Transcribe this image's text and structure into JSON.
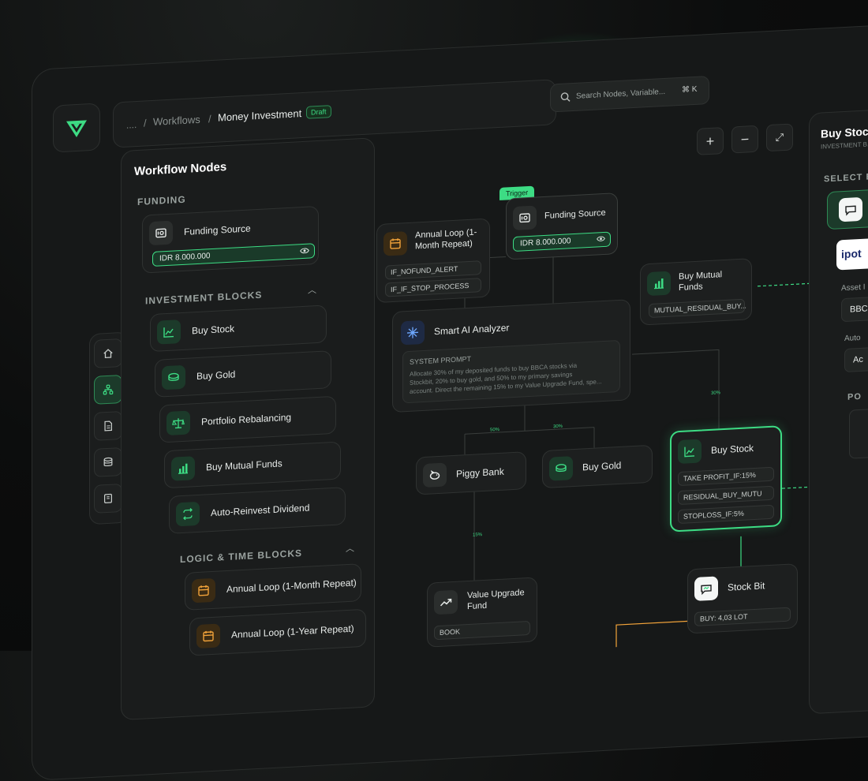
{
  "breadcrumb": {
    "ellipsis": "....",
    "sep1": "/",
    "workflows": "Workflows",
    "sep2": "/",
    "current": "Money Investment",
    "badge": "Draft"
  },
  "search": {
    "placeholder": "Search Nodes, Variable...",
    "shortcut": "⌘ K"
  },
  "toolbar": {
    "zoom_in": "+",
    "zoom_out": "−",
    "fullscreen": "⤢"
  },
  "left_panel": {
    "title": "Workflow Nodes",
    "funding_section": "FUNDING",
    "funding_node": {
      "label": "Funding Source",
      "value": "IDR 8.000.000"
    },
    "investment_section": "INVESTMENT BLOCKS",
    "investment_items": [
      {
        "label": "Buy Stock",
        "icon": "stock-chart-icon"
      },
      {
        "label": "Buy Gold",
        "icon": "gold-coin-icon"
      },
      {
        "label": "Portfolio Rebalancing",
        "icon": "balance-scale-icon"
      },
      {
        "label": "Buy Mutual Funds",
        "icon": "bar-chart-icon"
      },
      {
        "label": "Auto-Reinvest Dividend",
        "icon": "repeat-icon"
      }
    ],
    "logic_section": "LOGIC & TIME BLOCKS",
    "logic_items": [
      {
        "label": "Annual Loop (1-Month Repeat)",
        "icon": "calendar-icon"
      },
      {
        "label": "Annual Loop (1-Year Repeat)",
        "icon": "calendar-icon"
      }
    ]
  },
  "canvas": {
    "trigger_badge": "Trigger",
    "funding_source": {
      "title": "Funding Source",
      "value": "IDR 8.000.000"
    },
    "annual_loop": {
      "title_line1": "Annual Loop (1-",
      "title_line2": "Month Repeat)",
      "pills": [
        "IF_NOFUND_ALERT",
        "IF_IF_STOP_PROCESS"
      ]
    },
    "buy_mutual_funds": {
      "title_line1": "Buy Mutual",
      "title_line2": "Funds",
      "pill": "MUTUAL_RESIDUAL_BUY..."
    },
    "smart_ai": {
      "title": "Smart AI Analyzer",
      "prompt_label": "SYSTEM PROMPT",
      "prompt_line1": "Allocate 30% of my deposited funds to buy BBCA stocks via",
      "prompt_line2": "Stockbit, 20% to buy gold, and 50% to my primary savings",
      "prompt_line3": "account. Direct the remaining 15% to my Value Upgrade Fund, spe..."
    },
    "piggy_bank": {
      "title": "Piggy Bank"
    },
    "buy_gold": {
      "title": "Buy Gold"
    },
    "buy_stock": {
      "title": "Buy Stock",
      "pills": [
        "TAKE PROFIT_IF:15%",
        "RESIDUAL_BUY_MUTU",
        "STOPLOSS_IF:5%"
      ]
    },
    "value_upgrade": {
      "title_line1": "Value Upgrade",
      "title_line2": "Fund",
      "pill": "BOOK"
    },
    "stock_bit": {
      "title": "Stock Bit",
      "pill": "BUY: 4,03 LOT"
    },
    "edge_labels": [
      "50%",
      "30%",
      "30%",
      "15%"
    ]
  },
  "right_panel": {
    "title": "Buy Stock",
    "subtitle": "INVESTMENT B...",
    "select_label": "SELECT B",
    "ipot_label": "ipot",
    "asset_label": "Asset I",
    "asset_value": "BBC",
    "auto_label": "Auto",
    "auto_value": "Ac",
    "po_label": "PO"
  },
  "colors": {
    "accent": "#3ddc84",
    "background": "#161818",
    "orange": "#f2a33a"
  }
}
